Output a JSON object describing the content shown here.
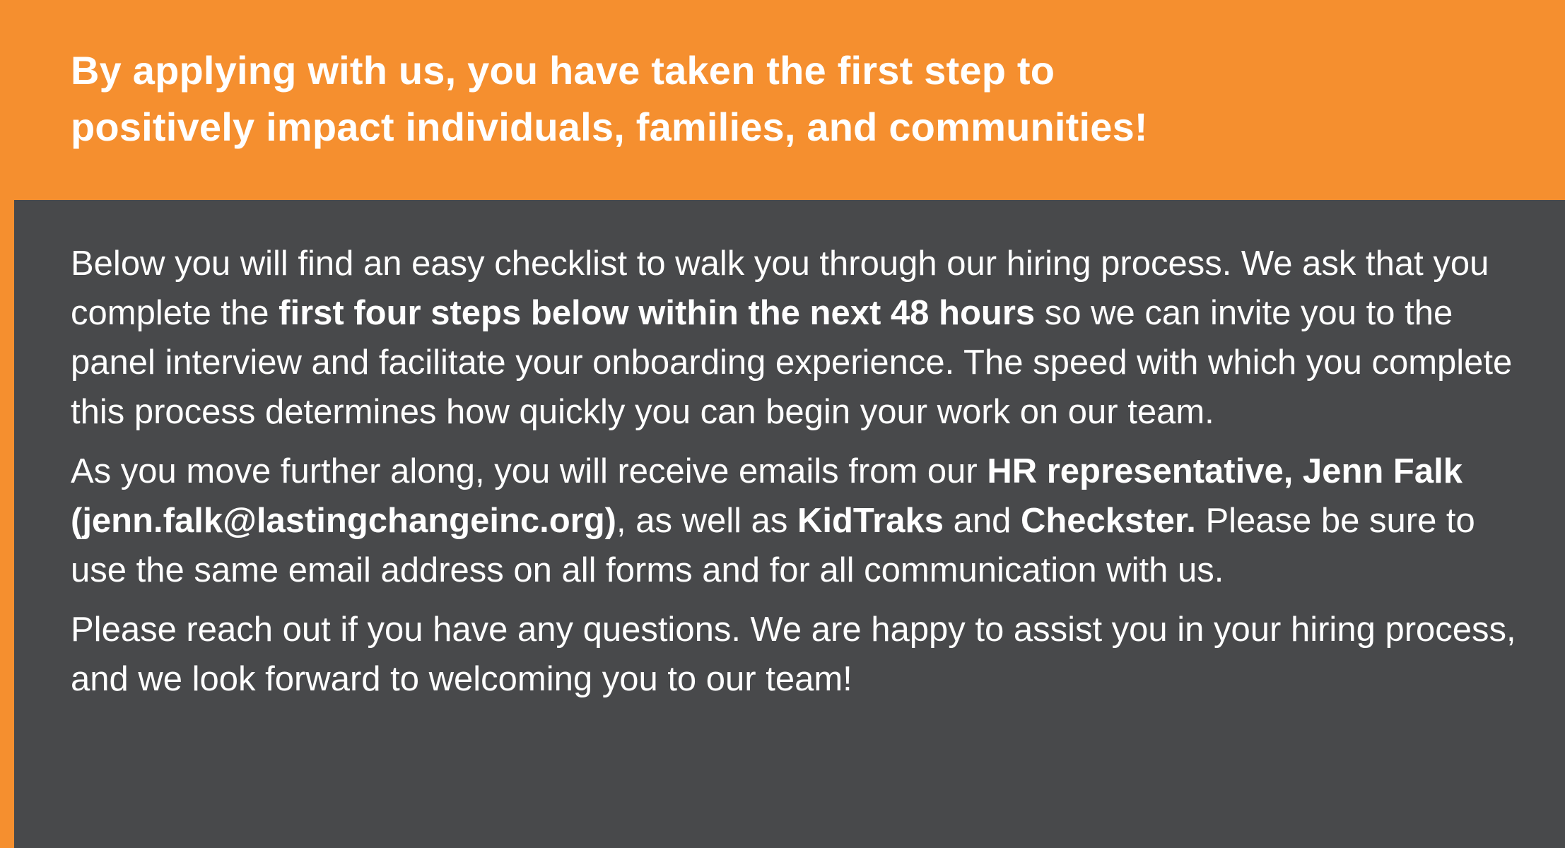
{
  "header": {
    "headline_line1": "By applying with us, you have taken the first step to",
    "headline_line2": "positively impact individuals, families, and communities!"
  },
  "paragraph1": {
    "text_a": "Below you will find an easy checklist to walk you through our hiring process. We ask that you complete the ",
    "bold_a": "first four steps below within the next 48 hours",
    "text_b": " so we can invite you to the panel interview and facilitate your onboarding experience. The speed with which you complete this process determines how quickly you can begin your work on our team."
  },
  "paragraph2": {
    "text_a": "As you move further along, you will receive emails from our ",
    "bold_a": "HR representative, Jenn Falk (jenn.falk@lastingchangeinc.org)",
    "text_b": ", as well as ",
    "bold_b": "KidTraks",
    "text_c": " and ",
    "bold_c": "Checkster.",
    "text_d": " Please be sure to use the same email address on all forms and for all communication with us."
  },
  "paragraph3": {
    "text": "Please reach out if you have any questions. We are happy to assist you in your hiring process, and we look forward to welcoming you to our team!"
  },
  "colors": {
    "accent_orange": "#F58F2F",
    "panel_gray": "#48494B",
    "text": "#FFFFFF"
  }
}
